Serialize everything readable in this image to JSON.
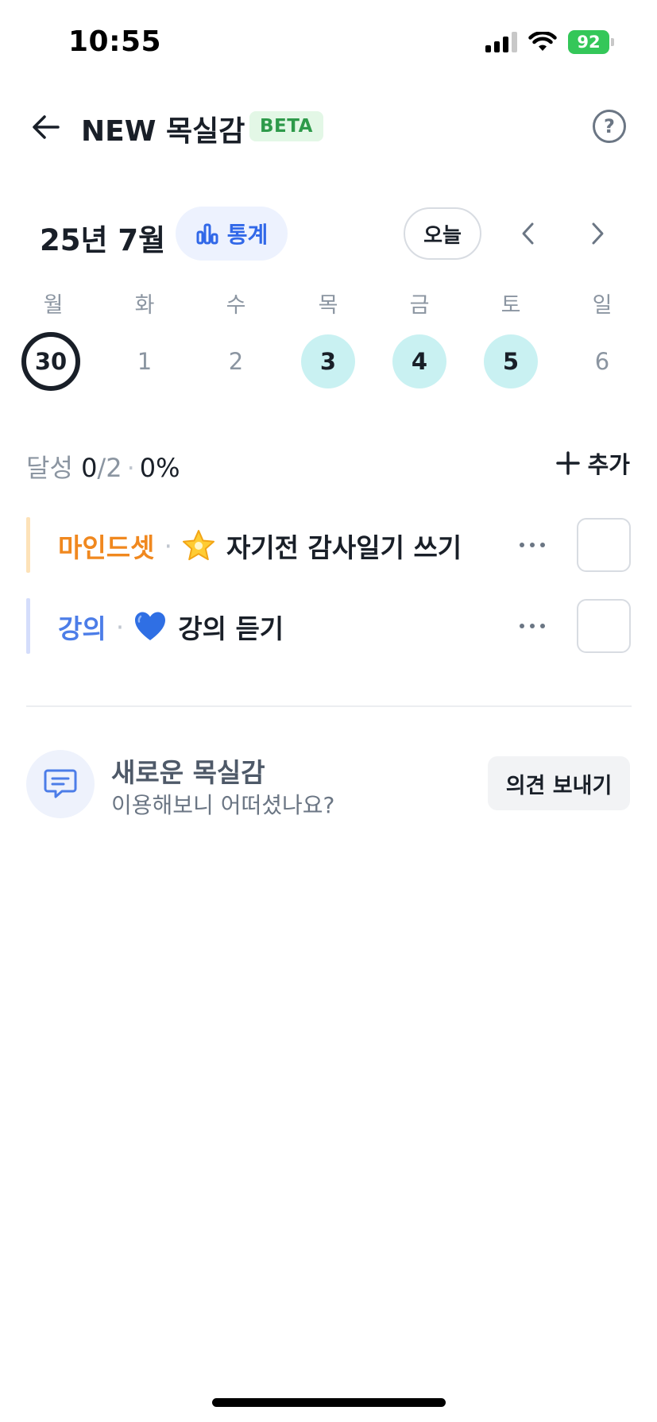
{
  "status_bar": {
    "time": "10:55",
    "battery": "92"
  },
  "header": {
    "title": "NEW 목실감",
    "badge": "BETA",
    "help_label": "?"
  },
  "calendar": {
    "month_label": "25년 7월",
    "stats_label": "통계",
    "today_label": "오늘",
    "weekdays": [
      "월",
      "화",
      "수",
      "목",
      "금",
      "토",
      "일"
    ],
    "days": [
      {
        "label": "30",
        "state": "today"
      },
      {
        "label": "1",
        "state": "none"
      },
      {
        "label": "2",
        "state": "none"
      },
      {
        "label": "3",
        "state": "done"
      },
      {
        "label": "4",
        "state": "done"
      },
      {
        "label": "5",
        "state": "done"
      },
      {
        "label": "6",
        "state": "none"
      }
    ],
    "done_color": "#c9f1f2"
  },
  "progress": {
    "label": "달성",
    "done": "0",
    "total": "/2",
    "percent": "0%",
    "add_label": "추가"
  },
  "tasks": [
    {
      "category": "마인드셋",
      "category_color": "#f0881f",
      "bar_color": "#fde2b8",
      "emoji": "star-icon",
      "title": "자기전 감사일기 쓰기",
      "checked": false
    },
    {
      "category": "강의",
      "category_color": "#4c7de8",
      "bar_color": "#d4ddfb",
      "emoji": "blue-heart-icon",
      "title": "강의 듣기",
      "checked": false
    }
  ],
  "feedback": {
    "title": "새로운 목실감",
    "subtitle": "이용해보니 어떠셨나요?",
    "button_label": "의견 보내기"
  },
  "colors": {
    "accent": "#3168e8",
    "beta_bg": "#e3f7e6",
    "beta_text": "#2e9a4a"
  }
}
